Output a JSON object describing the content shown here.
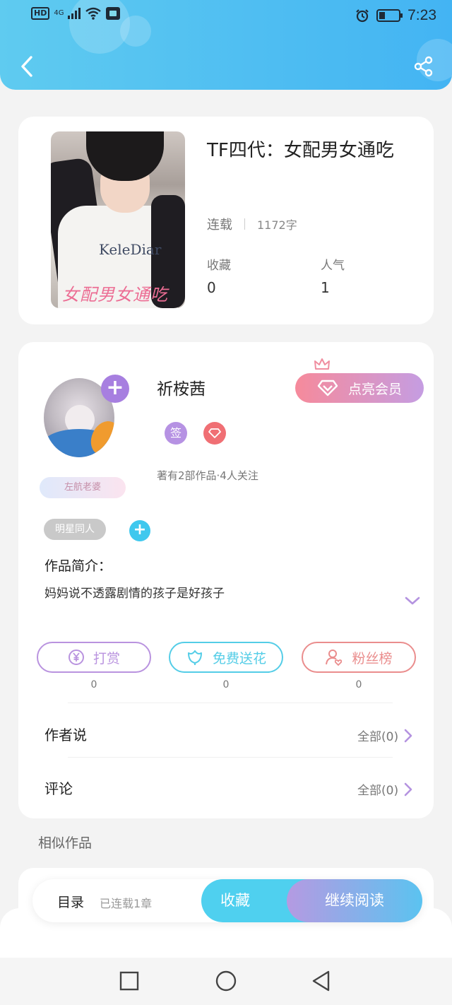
{
  "status_bar": {
    "network_badge": "HD",
    "network_type": "4G",
    "time": "7:23"
  },
  "header": {
    "back_icon": "chevron-left-icon",
    "share_icon": "share-icon"
  },
  "book": {
    "title": "TF四代：女配男女通吃",
    "cover_caption": "女配男女通吃",
    "cover_shirt_text": "KeleDiar",
    "status": "连载",
    "word_count": "1172字",
    "stats": [
      {
        "label": "收藏",
        "value": "0"
      },
      {
        "label": "人气",
        "value": "1"
      }
    ]
  },
  "author": {
    "name": "祈桉茜",
    "avatar_tag": "左航老婆",
    "vip_button": "点亮会员",
    "badges": [
      "签"
    ],
    "stats_text": "著有2部作品·4人关注",
    "genre_tag": "明星同人",
    "intro_label": "作品简介：",
    "intro_text": "妈妈说不透露剧情的孩子是好孩子"
  },
  "actions": [
    {
      "label": "打赏",
      "count": "0",
      "icon": "yen-icon",
      "color": "#b993df"
    },
    {
      "label": "免费送花",
      "count": "0",
      "icon": "flower-icon",
      "color": "#54cde7"
    },
    {
      "label": "粉丝榜",
      "count": "0",
      "icon": "fan-icon",
      "color": "#ea8d8d"
    }
  ],
  "rows": [
    {
      "label": "作者说",
      "link": "全部(0)"
    },
    {
      "label": "评论",
      "link": "全部(0)"
    }
  ],
  "similar": {
    "title": "相似作品"
  },
  "bottom_bar": {
    "toc": "目录",
    "chapter_info": "已连载1章",
    "favorite": "收藏",
    "continue_reading": "继续阅读"
  },
  "colors": {
    "header_gradient": [
      "#5fcbf0",
      "#43b4f3"
    ],
    "purple_accent": "#a77fe0",
    "cyan_accent": "#4fd0ef",
    "pink_accent": "#f68a9b"
  }
}
